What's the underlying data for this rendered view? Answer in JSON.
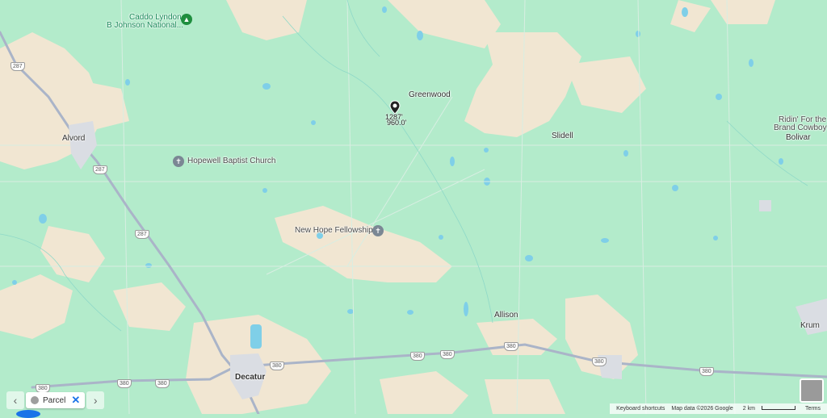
{
  "map": {
    "towns": {
      "alvord": "Alvord",
      "greenwood": "Greenwood",
      "slidell": "Slidell",
      "bolivar": "Bolivar",
      "allison": "Allison",
      "krum": "Krum",
      "decatur": "Decatur"
    },
    "pois": {
      "caddo_line1": "Caddo Lyndon",
      "caddo_line2": "B Johnson National...",
      "hopewell": "Hopewell Baptist Church",
      "new_hope": "New Hope Fellowship",
      "ridin_line1": "Ridin' For the",
      "ridin_line2": "Brand Cowboy"
    },
    "route_shields": {
      "r287_a": "287",
      "r287_b": "287",
      "r287_c": "287",
      "r380_a": "380",
      "r380_b": "380",
      "r380_c": "380",
      "r380_d": "380",
      "r380_e": "380",
      "r380_f": "380",
      "r380_g": "380",
      "r380_h": "380",
      "r380_i": "380"
    },
    "marker": {
      "line1": "1287'",
      "line2": "960.0'"
    },
    "colors": {
      "land_green": "#b3ebcb",
      "land_tan": "#f3e6d0",
      "road_gray": "#aab4c8",
      "water": "#7fcfe8"
    }
  },
  "chip_bar": {
    "prev_icon": "chevron-left-icon",
    "next_icon": "chevron-right-icon",
    "chip_label": "Parcel",
    "close_icon": "close-icon"
  },
  "footer": {
    "keyboard": "Keyboard shortcuts",
    "map_data": "Map data ©2026 Google",
    "scale": "2 km",
    "terms": "Terms"
  }
}
